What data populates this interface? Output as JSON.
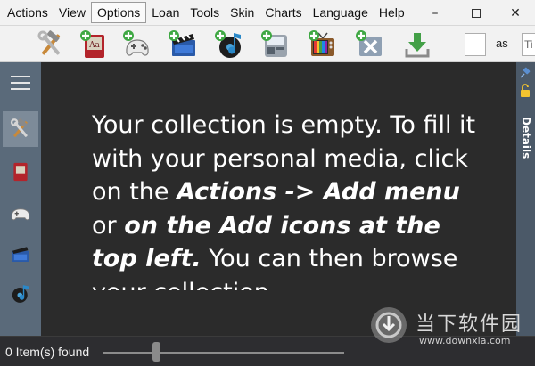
{
  "menu": {
    "items": [
      "Actions",
      "View",
      "Options",
      "Loan",
      "Tools",
      "Skin",
      "Charts",
      "Language",
      "Help"
    ],
    "active": "Options"
  },
  "window_controls": {
    "minimize": "–",
    "close": "✕"
  },
  "toolbar": {
    "icons": [
      "tools-icon",
      "add-book-icon",
      "add-game-icon",
      "add-movie-icon",
      "add-music-icon",
      "add-software-icon",
      "add-tv-icon",
      "add-other-icon",
      "download-icon"
    ],
    "search_value": "",
    "as_label": "as",
    "select_value": "Ti"
  },
  "sidebar": {
    "items": [
      "tools-icon",
      "book-icon",
      "game-icon",
      "movie-icon",
      "music-icon"
    ],
    "selected": "tools-icon"
  },
  "main": {
    "msg_1": "Your collection is empty. To fill it with your personal media, click on the ",
    "msg_bold_1": "Actions -> Add menu",
    "msg_2": " or ",
    "msg_bold_2": "on the Add icons at the top left.",
    "msg_3": " You can then browse your collection"
  },
  "details_panel": {
    "label": "Details"
  },
  "status": {
    "items_found": "0 Item(s) found",
    "zoom_level": 0.22
  },
  "watermark": {
    "name": "当下软件园",
    "url": "www.downxia.com"
  },
  "colors": {
    "main_bg": "#2b2b2b",
    "sidebar_bg": "#5a6a7a",
    "menubar_bg": "#f2f2f2",
    "details_bg": "#4b5968"
  }
}
